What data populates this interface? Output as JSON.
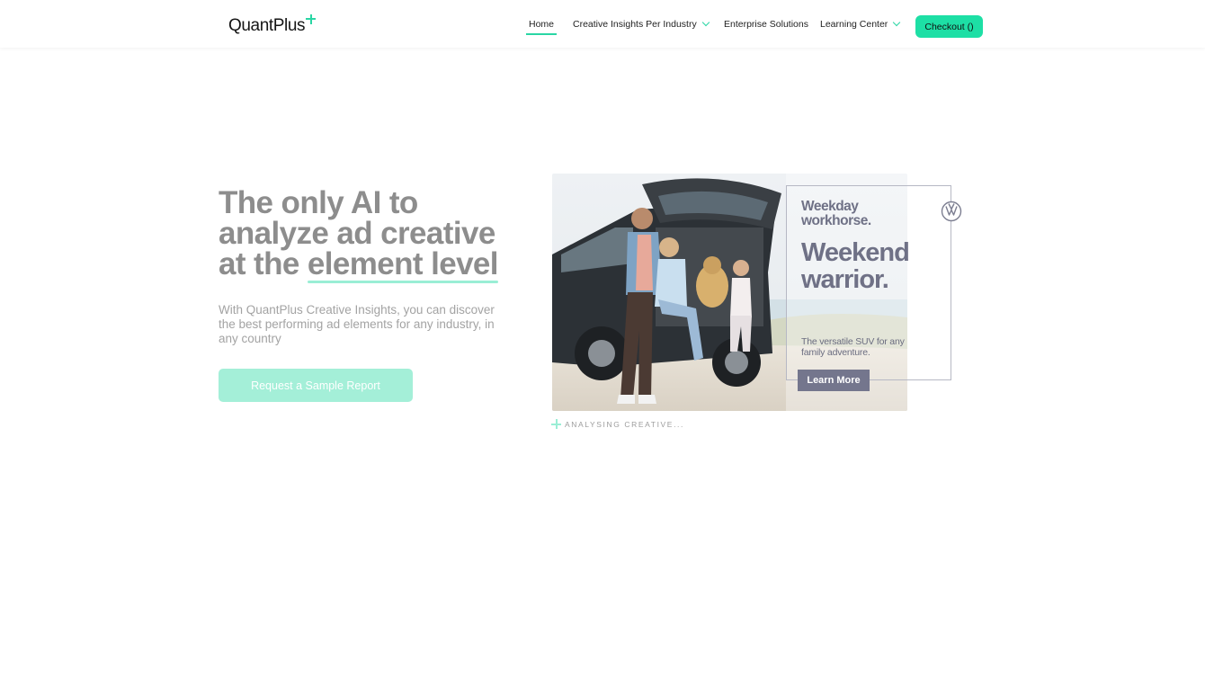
{
  "brand": {
    "name": "QuantPlus",
    "accent_color": "#1ddfa5"
  },
  "nav": {
    "items": [
      {
        "label": "Home",
        "active": true
      },
      {
        "label": "Creative Insights Per Industry",
        "has_dropdown": true
      },
      {
        "label": "Enterprise Solutions"
      },
      {
        "label": "Learning Center",
        "has_dropdown": true
      }
    ],
    "checkout_label": "Checkout ()"
  },
  "hero": {
    "title_line1": "The only AI to",
    "title_line2": "analyze ad creative",
    "title_line3_prefix": "at the ",
    "title_highlight": "element level",
    "subtitle": "With QuantPlus Creative Insights, you can discover the best performing ad elements for any industry, in any country",
    "cta_label": "Request a Sample Report"
  },
  "creative": {
    "kicker": "Weekday workhorse.",
    "headline": "Weekend warrior.",
    "body": "The versatile SUV for any family adventure.",
    "button_label": "Learn More",
    "brand_icon": "vw-logo-icon",
    "status_label": "ANALYSING CREATIVE..."
  }
}
